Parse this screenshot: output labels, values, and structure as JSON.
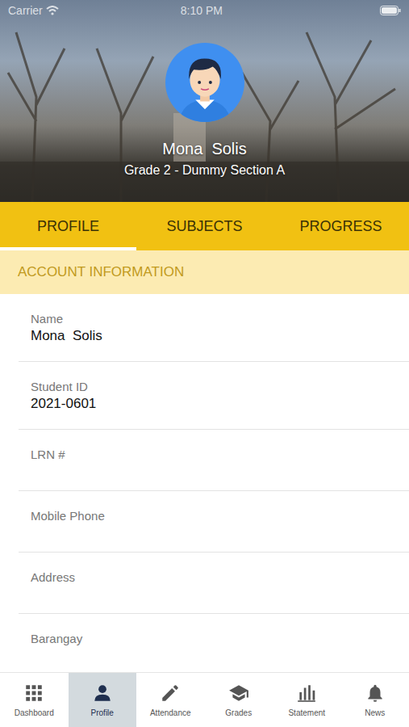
{
  "status_bar": {
    "carrier": "Carrier",
    "time": "8:10 PM"
  },
  "header": {
    "name": "Mona  Solis",
    "subtitle": "Grade 2 - Dummy Section A"
  },
  "tabs": [
    {
      "label": "PROFILE",
      "selected": true
    },
    {
      "label": "SUBJECTS",
      "selected": false
    },
    {
      "label": "PROGRESS",
      "selected": false
    }
  ],
  "section_title": "ACCOUNT INFORMATION",
  "fields": [
    {
      "label": "Name",
      "value": "Mona  Solis"
    },
    {
      "label": "Student ID",
      "value": "2021-0601"
    },
    {
      "label": "LRN #"
    },
    {
      "label": "Mobile Phone"
    },
    {
      "label": "Address"
    },
    {
      "label": "Barangay"
    }
  ],
  "nav": [
    {
      "label": "Dashboard",
      "selected": false
    },
    {
      "label": "Profile",
      "selected": true
    },
    {
      "label": "Attendance",
      "selected": false
    },
    {
      "label": "Grades",
      "selected": false
    },
    {
      "label": "Statement",
      "selected": false
    },
    {
      "label": "News",
      "selected": false
    }
  ]
}
